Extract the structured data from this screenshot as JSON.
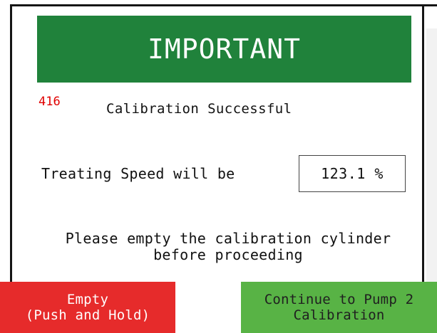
{
  "header": {
    "title": "IMPORTANT"
  },
  "message": {
    "code": "416",
    "status": "Calibration Successful"
  },
  "speed": {
    "label": "Treating Speed will be",
    "value": "123.1 %"
  },
  "instruction": {
    "line1": "Please empty the calibration cylinder",
    "line2": "before proceeding"
  },
  "buttons": {
    "empty": {
      "line1": "Empty",
      "line2": "(Push and Hold)"
    },
    "continue": {
      "line1": "Continue to Pump 2",
      "line2": "Calibration"
    }
  },
  "colors": {
    "header": "#20823b",
    "code": "#e00000",
    "empty_button": "#e62b2b",
    "continue_button": "#58b345"
  }
}
